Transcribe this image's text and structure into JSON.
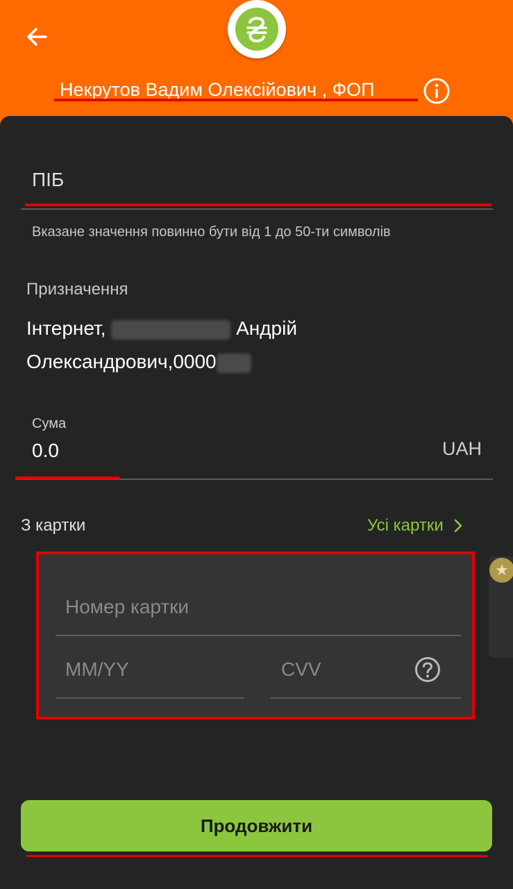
{
  "header": {
    "back_icon": "arrow-left-icon",
    "logo_icon": "hryvnia-icon",
    "merchant_name": "Некрутов Вадим Олексійович , ФОП",
    "info_icon": "info-icon"
  },
  "form": {
    "pib_placeholder": "ПІБ",
    "pib_hint": "Вказане значення повинно бути від 1 до 50-ти символів",
    "purpose_label": "Призначення",
    "purpose_line1_start": "Інтернет,",
    "purpose_line1_end": "Андрій",
    "purpose_line2": "Олександрович,0000",
    "amount_label": "Сума",
    "amount_value": "0.0",
    "currency": "UAH"
  },
  "cards": {
    "from_label": "З картки",
    "all_cards_label": "Усі картки",
    "card_number_placeholder": "Номер картки",
    "expiry_placeholder": "MM/YY",
    "cvv_placeholder": "CVV",
    "help_icon": "question-circle-icon",
    "badge_icon": "star-icon"
  },
  "actions": {
    "continue_label": "Продовжити"
  },
  "colors": {
    "accent_orange": "#ff6a00",
    "accent_green": "#8cc63f",
    "background_dark": "#242424",
    "highlight_red": "#e40000"
  }
}
